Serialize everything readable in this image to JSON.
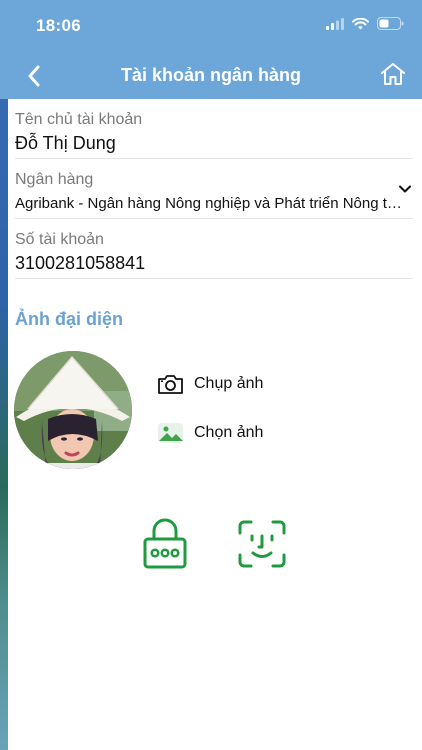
{
  "status_bar": {
    "time": "18:06"
  },
  "nav": {
    "title": "Tài khoản ngân hàng"
  },
  "form": {
    "holder_label": "Tên chủ tài khoản",
    "holder_value": "Đỗ Thị Dung",
    "bank_label": "Ngân hàng",
    "bank_value": "Agribank - Ngân hàng Nông nghiệp và Phát triển Nông thôn Việt Nam",
    "account_label": "Số tài khoản",
    "account_value": "3100281058841"
  },
  "avatar_section": {
    "title": "Ảnh đại diện",
    "take_photo_label": "Chụp ảnh",
    "choose_photo_label": "Chọn ảnh"
  },
  "colors": {
    "header_bg": "#6da6d9",
    "section_title": "#6aa3d3",
    "security_icons": "#1f9a3e"
  },
  "icons": [
    "back-arrow-icon",
    "home-icon",
    "chevron-down-icon",
    "camera-icon",
    "image-icon",
    "password-lock-icon",
    "face-id-icon"
  ]
}
